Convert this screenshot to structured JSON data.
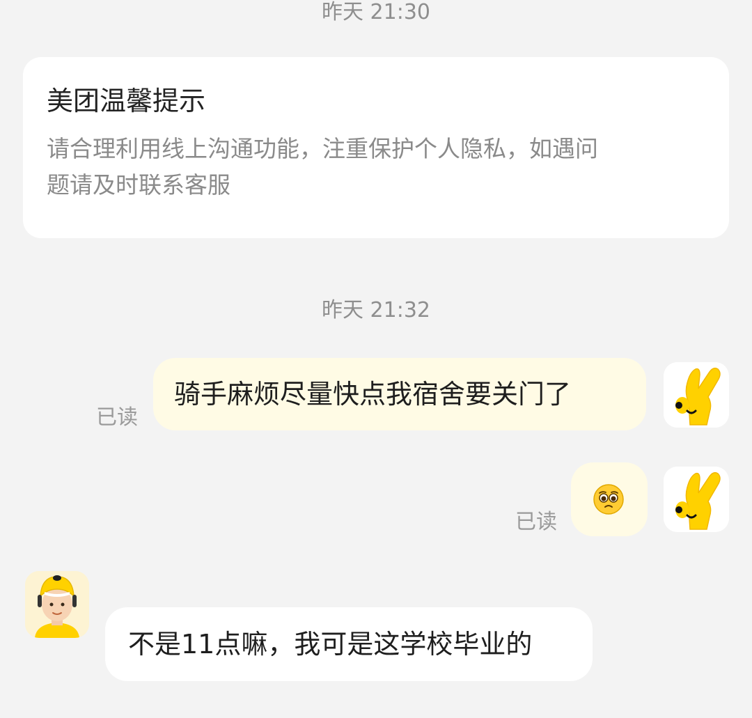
{
  "chat": {
    "timestamps": [
      "昨天 21:30",
      "昨天 21:32"
    ],
    "system_notice": {
      "title": "美团温馨提示",
      "body_line1": "请合理利用线上沟通功能，注重保护个人隐私，如遇问",
      "body_line2": "题请及时联系客服"
    },
    "messages": [
      {
        "sender": "self",
        "text": "骑手麻烦尽量快点我宿舍要关门了",
        "status": "已读",
        "avatar_icon": "kangaroo-ears-hand-icon"
      },
      {
        "sender": "self",
        "emoji": "pleading-face-emoji",
        "status": "已读",
        "avatar_icon": "kangaroo-ears-hand-icon"
      },
      {
        "sender": "rider",
        "text": "不是11点嘛，我可是这学校毕业的",
        "avatar_icon": "rider-helmet-avatar-icon"
      }
    ]
  },
  "colors": {
    "page_background": "#f3f3f3",
    "outgoing_bubble": "#fffbe5",
    "incoming_bubble": "#ffffff",
    "brand_yellow": "#ffd100"
  }
}
